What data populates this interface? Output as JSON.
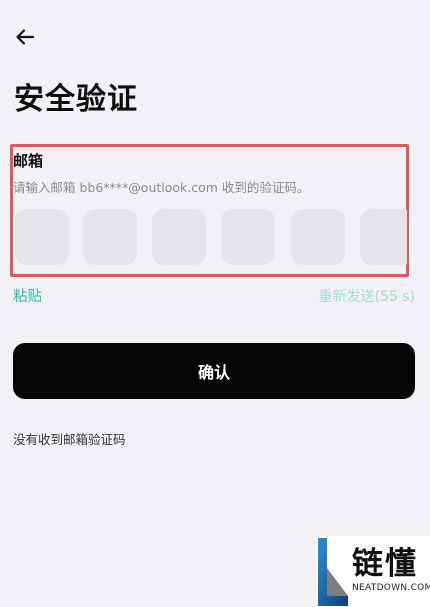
{
  "header": {
    "back_icon": "arrow-left-icon"
  },
  "page": {
    "title": "安全验证"
  },
  "email_section": {
    "label": "邮箱",
    "hint": "请输入邮箱 bb6****@outlook.com 收到的验证码。",
    "code_slots": [
      "",
      "",
      "",
      "",
      "",
      ""
    ]
  },
  "actions": {
    "paste_label": "粘贴",
    "resend_label": "重新发送(55 s)",
    "confirm_label": "确认",
    "no_code_label": "没有收到邮箱验证码"
  },
  "watermark": {
    "name": "链懂",
    "domain": "NEATDOWN.COM"
  },
  "colors": {
    "background": "#f3f1f6",
    "accent": "#2bb8b0",
    "accent_muted": "#9fdcd8",
    "button": "#050505",
    "highlight": "#e2585d",
    "code_box": "#e7e5ea"
  }
}
